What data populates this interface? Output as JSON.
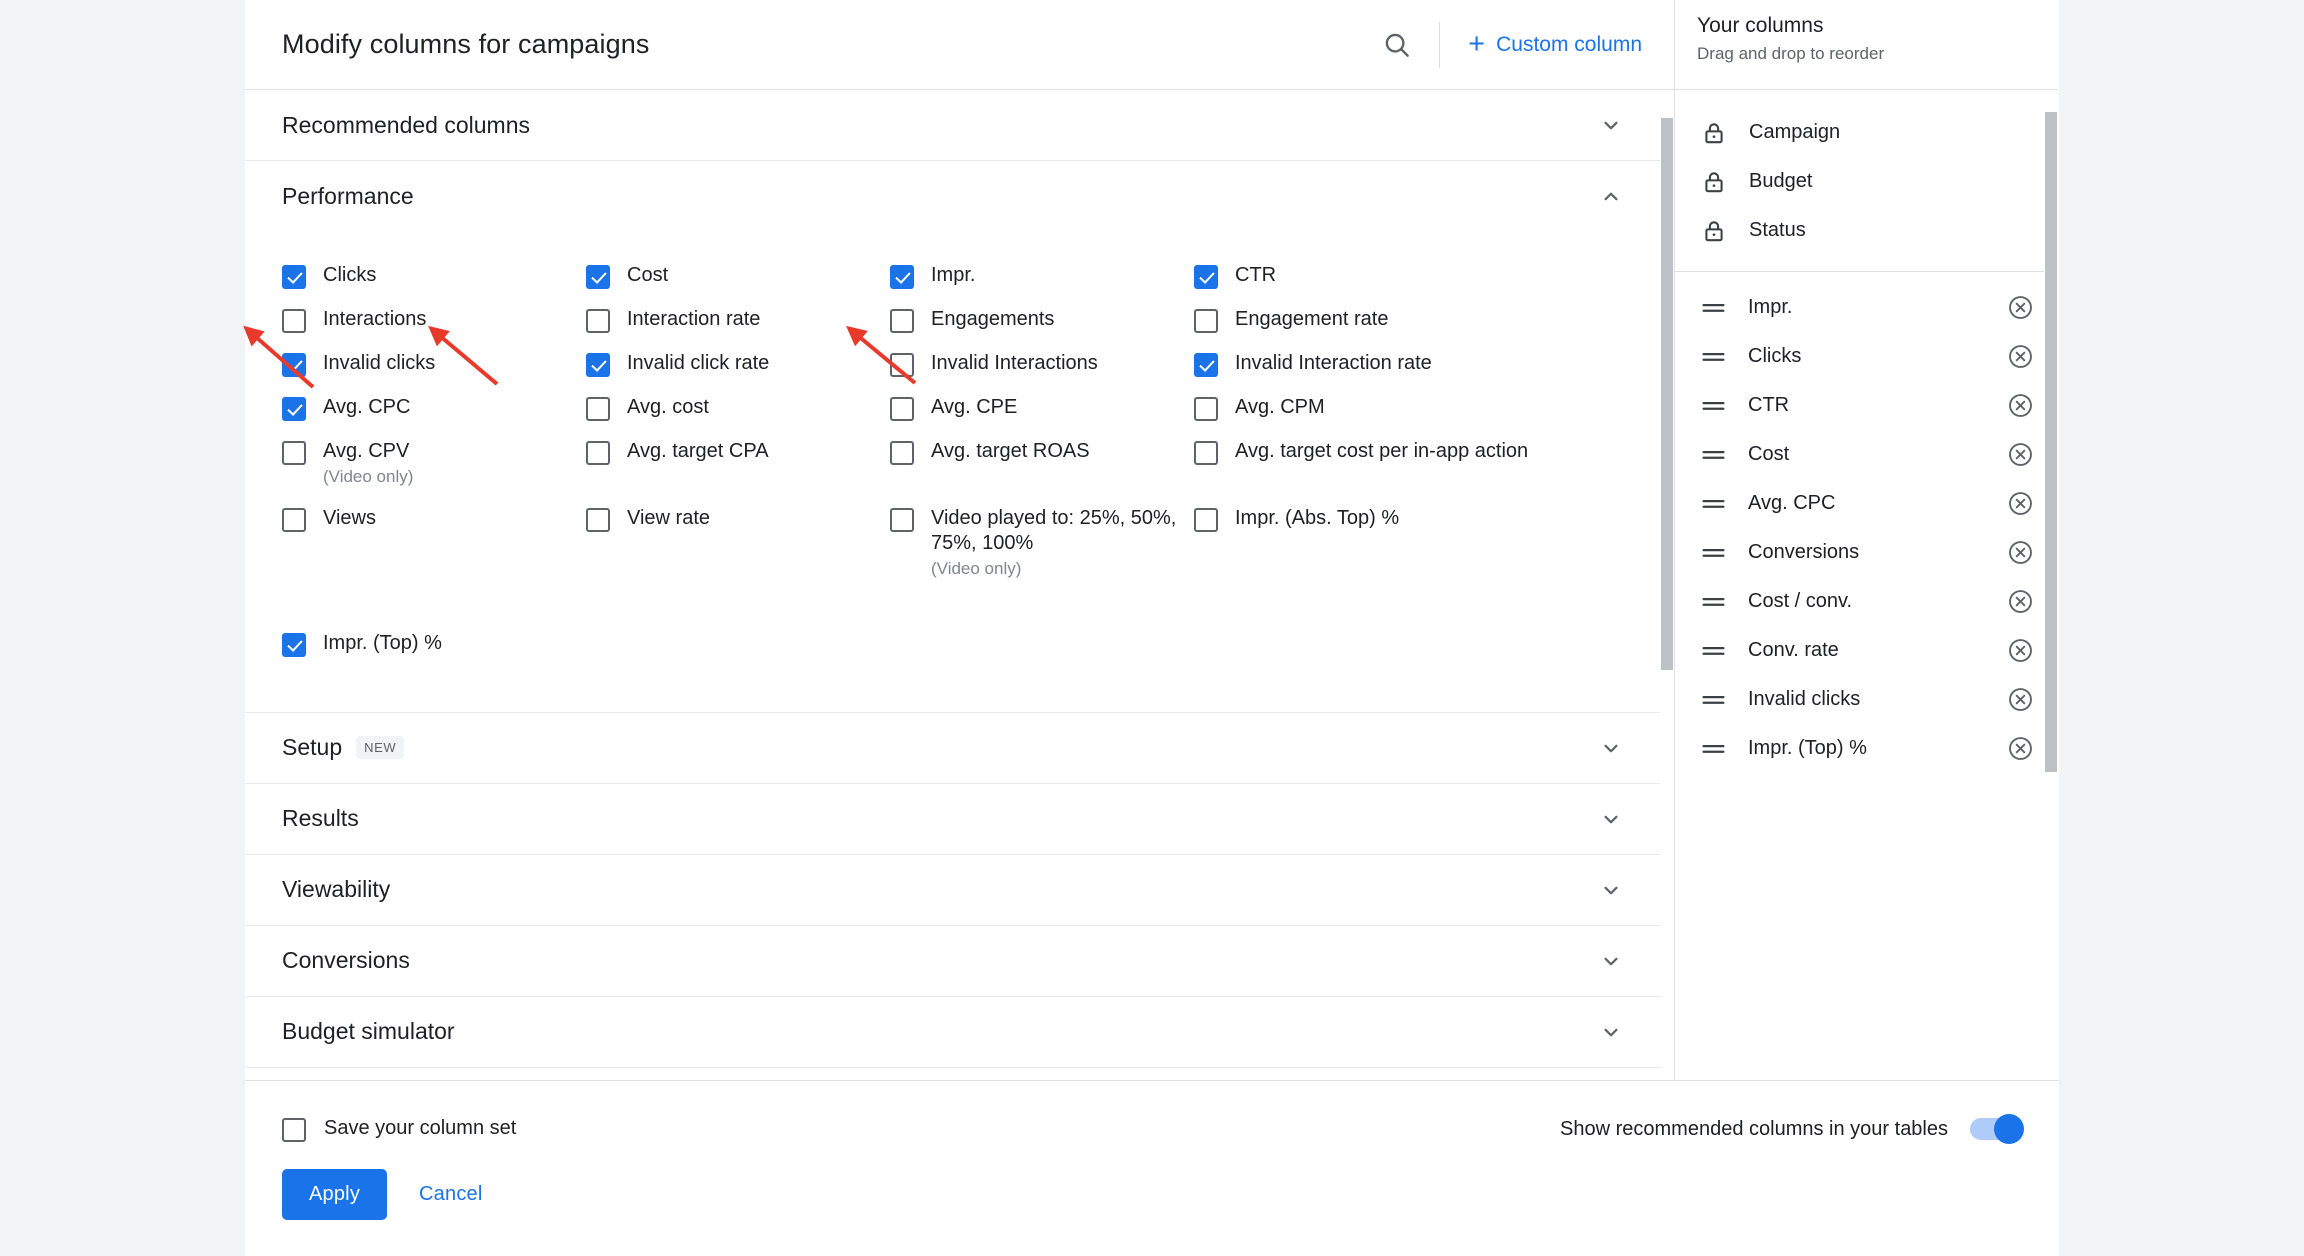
{
  "dialog": {
    "title": "Modify columns for campaigns",
    "search_icon": "search-icon",
    "custom_column_label": "Custom column",
    "plus_icon": "+"
  },
  "sections": [
    {
      "id": "recommended",
      "title": "Recommended columns",
      "expanded": false,
      "badge": ""
    },
    {
      "id": "performance",
      "title": "Performance",
      "expanded": true,
      "badge": ""
    },
    {
      "id": "setup",
      "title": "Setup",
      "expanded": false,
      "badge": "NEW"
    },
    {
      "id": "results",
      "title": "Results",
      "expanded": false,
      "badge": ""
    },
    {
      "id": "viewability",
      "title": "Viewability",
      "expanded": false,
      "badge": ""
    },
    {
      "id": "conversions",
      "title": "Conversions",
      "expanded": false,
      "badge": ""
    },
    {
      "id": "budget-simulator",
      "title": "Budget simulator",
      "expanded": false,
      "badge": ""
    }
  ],
  "performance_options": [
    {
      "label": "Clicks",
      "sub": "",
      "checked": true
    },
    {
      "label": "Cost",
      "sub": "",
      "checked": true
    },
    {
      "label": "Impr.",
      "sub": "",
      "checked": true
    },
    {
      "label": "CTR",
      "sub": "",
      "checked": true
    },
    {
      "label": "Interactions",
      "sub": "",
      "checked": false
    },
    {
      "label": "Interaction rate",
      "sub": "",
      "checked": false
    },
    {
      "label": "Engagements",
      "sub": "",
      "checked": false
    },
    {
      "label": "Engagement rate",
      "sub": "",
      "checked": false
    },
    {
      "label": "Invalid clicks",
      "sub": "",
      "checked": true
    },
    {
      "label": "Invalid click rate",
      "sub": "",
      "checked": true
    },
    {
      "label": "Invalid Interactions",
      "sub": "",
      "checked": false
    },
    {
      "label": "Invalid Interaction rate",
      "sub": "",
      "checked": true
    },
    {
      "label": "Avg. CPC",
      "sub": "",
      "checked": true
    },
    {
      "label": "Avg. cost",
      "sub": "",
      "checked": false
    },
    {
      "label": "Avg. CPE",
      "sub": "",
      "checked": false
    },
    {
      "label": "Avg. CPM",
      "sub": "",
      "checked": false
    },
    {
      "label": "Avg. CPV",
      "sub": "(Video only)",
      "checked": false
    },
    {
      "label": "Avg. target CPA",
      "sub": "",
      "checked": false
    },
    {
      "label": "Avg. target ROAS",
      "sub": "",
      "checked": false
    },
    {
      "label": "Avg. target cost per in-app action",
      "sub": "",
      "checked": false
    },
    {
      "label": "Views",
      "sub": "",
      "checked": false
    },
    {
      "label": "View rate",
      "sub": "",
      "checked": false
    },
    {
      "label": "Video played to: 25%, 50%, 75%, 100%",
      "sub": "(Video only)",
      "checked": false
    },
    {
      "label": "Impr. (Abs. Top) %",
      "sub": "",
      "checked": false
    }
  ],
  "performance_extra": {
    "label": "Impr. (Top) %",
    "sub": "",
    "checked": true
  },
  "your_columns": {
    "title": "Your columns",
    "subtitle": "Drag and drop to reorder",
    "locked": [
      {
        "label": "Campaign",
        "icon": "lock-icon"
      },
      {
        "label": "Budget",
        "icon": "lock-icon"
      },
      {
        "label": "Status",
        "icon": "lock-icon"
      }
    ],
    "items": [
      {
        "label": "Impr."
      },
      {
        "label": "Clicks"
      },
      {
        "label": "CTR"
      },
      {
        "label": "Cost"
      },
      {
        "label": "Avg. CPC"
      },
      {
        "label": "Conversions"
      },
      {
        "label": "Cost / conv."
      },
      {
        "label": "Conv. rate"
      },
      {
        "label": "Invalid clicks"
      },
      {
        "label": "Impr. (Top) %"
      }
    ]
  },
  "footer": {
    "save_column_set_label": "Save your column set",
    "save_column_set_checked": false,
    "show_recommended_label": "Show recommended columns in your tables",
    "show_recommended_on": true,
    "apply_label": "Apply",
    "cancel_label": "Cancel"
  },
  "colors": {
    "accent": "#1a73e8",
    "toggle_track": "#aecbfa",
    "annotation": "#ea4335",
    "text": "#202124",
    "muted": "#5f6368"
  },
  "annotations": {
    "arrow_color": "#e8392a",
    "count": 3
  }
}
